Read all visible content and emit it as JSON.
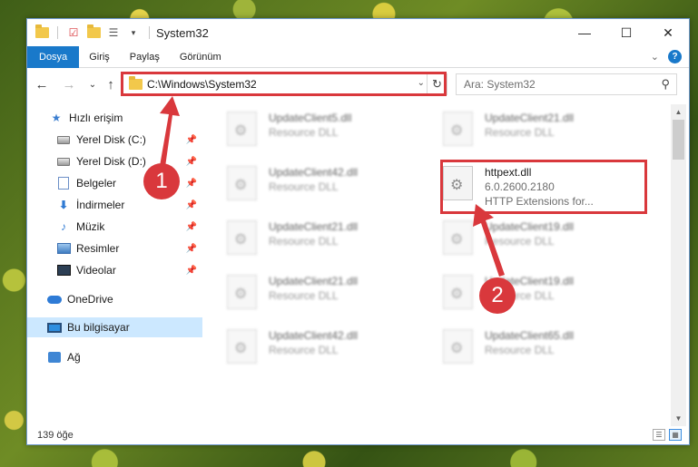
{
  "window": {
    "title": "System32",
    "controls": {
      "minimize": "—",
      "maximize": "☐",
      "close": "✕"
    }
  },
  "ribbon": {
    "tabs": [
      "Dosya",
      "Giriş",
      "Paylaş",
      "Görünüm"
    ],
    "active_tab": "Dosya",
    "help_label": "?"
  },
  "address": {
    "path": "C:\\Windows\\System32",
    "dropdown_glyph": "⌄",
    "refresh_glyph": "↻"
  },
  "search": {
    "placeholder": "Ara: System32"
  },
  "nav_buttons": {
    "back": "←",
    "forward": "→",
    "recent": "⌄",
    "up": "↑"
  },
  "sidebar": {
    "items": [
      {
        "label": "Hızlı erişim",
        "icon": "star-icon",
        "pinned": false
      },
      {
        "label": "Yerel Disk (C:)",
        "icon": "drive-icon",
        "pinned": true
      },
      {
        "label": "Yerel Disk (D:)",
        "icon": "drive-icon",
        "pinned": true
      },
      {
        "label": "Belgeler",
        "icon": "documents-icon",
        "pinned": true
      },
      {
        "label": "İndirmeler",
        "icon": "downloads-icon",
        "pinned": true
      },
      {
        "label": "Müzik",
        "icon": "music-icon",
        "pinned": true
      },
      {
        "label": "Resimler",
        "icon": "pictures-icon",
        "pinned": true
      },
      {
        "label": "Videolar",
        "icon": "videos-icon",
        "pinned": true
      },
      {
        "label": "OneDrive",
        "icon": "onedrive-icon",
        "pinned": false
      },
      {
        "label": "Bu bilgisayar",
        "icon": "this-pc-icon",
        "pinned": false,
        "selected": true
      },
      {
        "label": "Ağ",
        "icon": "network-icon",
        "pinned": false
      }
    ],
    "pin_glyph": "📌"
  },
  "files": [
    {
      "name": "UpdateClient5.dll",
      "type": "Resource DLL",
      "blurred": true
    },
    {
      "name": "UpdateClient21.dll",
      "type": "Resource DLL",
      "blurred": true
    },
    {
      "name": "UpdateClient42.dll",
      "type": "Resource DLL",
      "blurred": true
    },
    {
      "name": "httpext.dll",
      "version": "6.0.2600.2180",
      "type": "HTTP Extensions for...",
      "blurred": false,
      "highlighted": true
    },
    {
      "name": "UpdateClient21.dll",
      "type": "Resource DLL",
      "blurred": true
    },
    {
      "name": "UpdateClient19.dll",
      "type": "Resource DLL",
      "blurred": true
    },
    {
      "name": "UpdateClient21.dll",
      "type": "Resource DLL",
      "blurred": true
    },
    {
      "name": "UpdateClient19.dll",
      "type": "Resource DLL",
      "blurred": true
    },
    {
      "name": "UpdateClient42.dll",
      "type": "Resource DLL",
      "blurred": true
    },
    {
      "name": "UpdateClient65.dll",
      "type": "Resource DLL",
      "blurred": true
    }
  ],
  "status": {
    "item_count": "139 öğe"
  },
  "callouts": {
    "one": "1",
    "two": "2"
  },
  "colors": {
    "accent": "#1979ca",
    "highlight_red": "#d9383c",
    "selection": "#cce8ff"
  }
}
